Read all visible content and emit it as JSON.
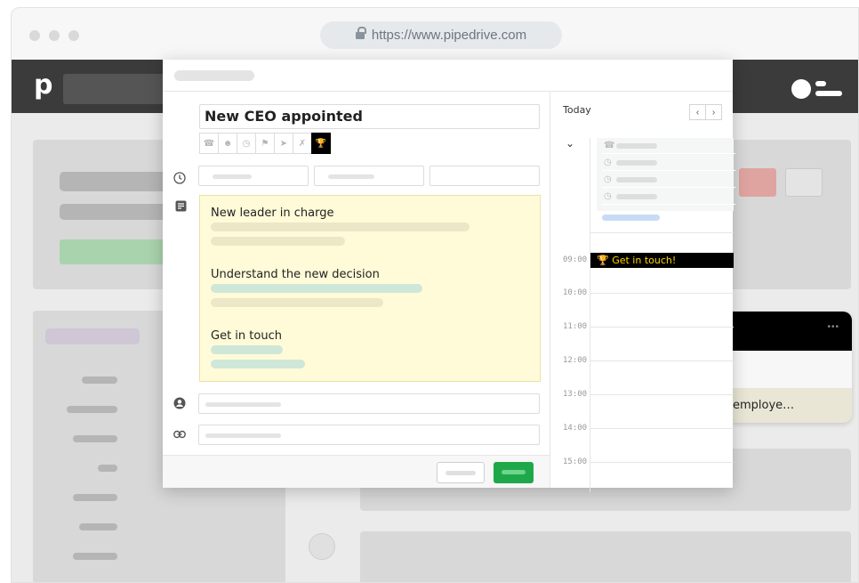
{
  "browser": {
    "url": "https://www.pipedrive.com"
  },
  "app": {
    "logo": "p"
  },
  "activity": {
    "title": "New CEO appointed",
    "types": [
      "call",
      "meeting",
      "task",
      "deadline",
      "email",
      "lunch",
      "goal"
    ],
    "active_type": "goal",
    "note_headings": [
      "New leader in charge",
      "Understand the new decision",
      "Get in touch"
    ]
  },
  "calendar": {
    "today_label": "Today",
    "hours": [
      "09:00",
      "10:00",
      "11:00",
      "12:00",
      "13:00",
      "14:00",
      "15:00"
    ],
    "event": {
      "label": "Get in touch!",
      "time": "09:00"
    }
  },
  "background_card": {
    "text": "employe…",
    "dots": "•••"
  },
  "colors": {
    "accent_green": "#1fa84a",
    "event_bg": "#000000",
    "event_fg": "#ffd400",
    "note_bg": "#fffbd8",
    "topbar": "#3b3b3b"
  }
}
